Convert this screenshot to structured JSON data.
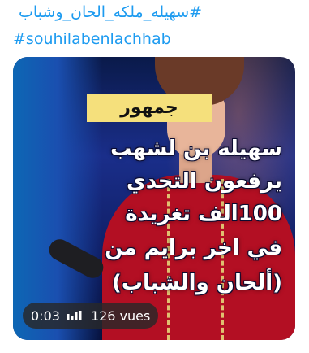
{
  "tweet": {
    "hashtags": {
      "arabic": "#سهيله_ملكه_الحان_وشباب",
      "latin": "#souhilabenlachhab"
    }
  },
  "video": {
    "label": "جمهور",
    "caption_lines": [
      "سهيله بن لشهب",
      "يرفعون التحدي",
      "100الف تغريدة",
      "في اخر برايم من",
      "(ألحان والشباب)"
    ],
    "time": "0:03",
    "views": "126 vues",
    "audio_icon": "audio-wave-icon",
    "colors": {
      "hashtag": "#1d9bf0",
      "label_bg": "#f5e07c",
      "dress": "#b30f23"
    }
  }
}
